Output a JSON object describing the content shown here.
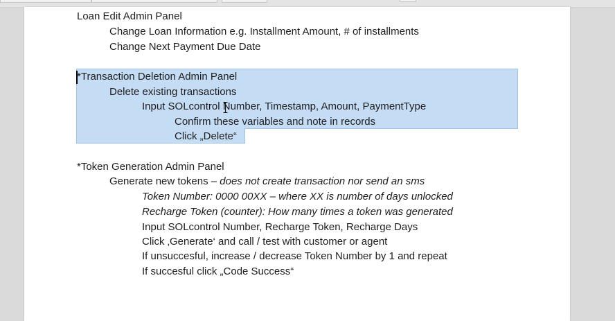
{
  "document": {
    "loan_section": {
      "title": "Loan Edit Admin Panel",
      "line1": "Change Loan Information e.g. Installment Amount, # of installments",
      "line2": "Change Next Payment Due Date"
    },
    "deletion_section": {
      "title": "*Transaction Deletion Admin Panel",
      "line1": "Delete existing transactions",
      "line2": "Input SOLcontrol Number, Timestamp, Amount, PaymentType",
      "line3": "Confirm these variables and note in records",
      "line4": "Click „Delete“"
    },
    "token_section": {
      "title": "*Token Generation Admin Panel",
      "line1_normal": "Generate new tokens  – ",
      "line1_italic": "does not create transaction nor send an sms",
      "line2": "Token Number: 0000 00XX – where XX is number of days unlocked",
      "line3": "Recharge Token (counter): How many times a token was generated",
      "line4": "Input SOLcontrol Number, Recharge Token, Recharge Days",
      "line5": "Click ‚Generate‘ and call / test with customer or agent",
      "line6": "If unsuccesful, increase / decrease Token Number by 1 and repeat",
      "line7": "If succesful click „Code Success“"
    }
  },
  "colors": {
    "selection": "#c5dcf5",
    "text": "#1d1d1d",
    "page": "#ffffff",
    "background": "#dadada"
  }
}
